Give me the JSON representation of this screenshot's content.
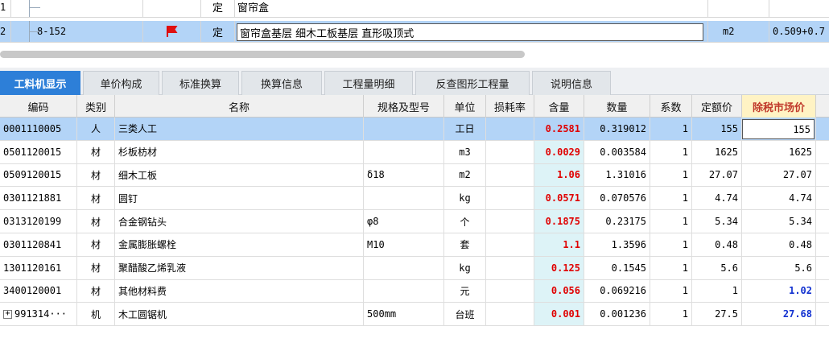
{
  "top_rows": [
    {
      "index": "1",
      "code": "",
      "type": "定",
      "name": "窗帘盒",
      "unit": "",
      "qty": ""
    },
    {
      "index": "2",
      "code": "8-152",
      "type": "定",
      "name": "窗帘盒基层 细木工板基层 直形吸顶式",
      "unit": "m2",
      "qty": "0.509+0.7"
    }
  ],
  "tabs": [
    "工料机显示",
    "单价构成",
    "标准换算",
    "换算信息",
    "工程量明细",
    "反查图形工程量",
    "说明信息"
  ],
  "columns": [
    "编码",
    "类别",
    "名称",
    "规格及型号",
    "单位",
    "损耗率",
    "含量",
    "数量",
    "系数",
    "定额价",
    "除税市场价"
  ],
  "rows": [
    {
      "code": "0001110005",
      "cat": "人",
      "name": "三类人工",
      "spec": "",
      "unit": "工日",
      "loss": "",
      "content": "0.2581",
      "amount": "0.319012",
      "coef": "1",
      "price": "155",
      "market": "155"
    },
    {
      "code": "0501120015",
      "cat": "材",
      "name": "杉板枋材",
      "spec": "",
      "unit": "m3",
      "loss": "",
      "content": "0.0029",
      "amount": "0.003584",
      "coef": "1",
      "price": "1625",
      "market": "1625"
    },
    {
      "code": "0509120015",
      "cat": "材",
      "name": "细木工板",
      "spec": "δ18",
      "unit": "m2",
      "loss": "",
      "content": "1.06",
      "amount": "1.31016",
      "coef": "1",
      "price": "27.07",
      "market": "27.07"
    },
    {
      "code": "0301121881",
      "cat": "材",
      "name": "圆钉",
      "spec": "",
      "unit": "kg",
      "loss": "",
      "content": "0.0571",
      "amount": "0.070576",
      "coef": "1",
      "price": "4.74",
      "market": "4.74"
    },
    {
      "code": "0313120199",
      "cat": "材",
      "name": "合金钢钻头",
      "spec": "φ8",
      "unit": "个",
      "loss": "",
      "content": "0.1875",
      "amount": "0.23175",
      "coef": "1",
      "price": "5.34",
      "market": "5.34"
    },
    {
      "code": "0301120841",
      "cat": "材",
      "name": "金属膨胀螺栓",
      "spec": "M10",
      "unit": "套",
      "loss": "",
      "content": "1.1",
      "amount": "1.3596",
      "coef": "1",
      "price": "0.48",
      "market": "0.48"
    },
    {
      "code": "1301120161",
      "cat": "材",
      "name": "聚醋酸乙烯乳液",
      "spec": "",
      "unit": "kg",
      "loss": "",
      "content": "0.125",
      "amount": "0.1545",
      "coef": "1",
      "price": "5.6",
      "market": "5.6"
    },
    {
      "code": "3400120001",
      "cat": "材",
      "name": "其他材料费",
      "spec": "",
      "unit": "元",
      "loss": "",
      "content": "0.056",
      "amount": "0.069216",
      "coef": "1",
      "price": "1",
      "market": "1.02"
    },
    {
      "code": "991314···",
      "cat": "机",
      "name": "木工圆锯机",
      "spec": "500mm",
      "unit": "台班",
      "loss": "",
      "content": "0.001",
      "amount": "0.001236",
      "coef": "1",
      "price": "27.5",
      "market": "27.68"
    }
  ],
  "colors": {
    "accent": "#2d7fd8",
    "selected": "#b3d4f7",
    "content_bg": "#ddf3f7",
    "red": "#e00000",
    "blue": "#1030d0"
  }
}
